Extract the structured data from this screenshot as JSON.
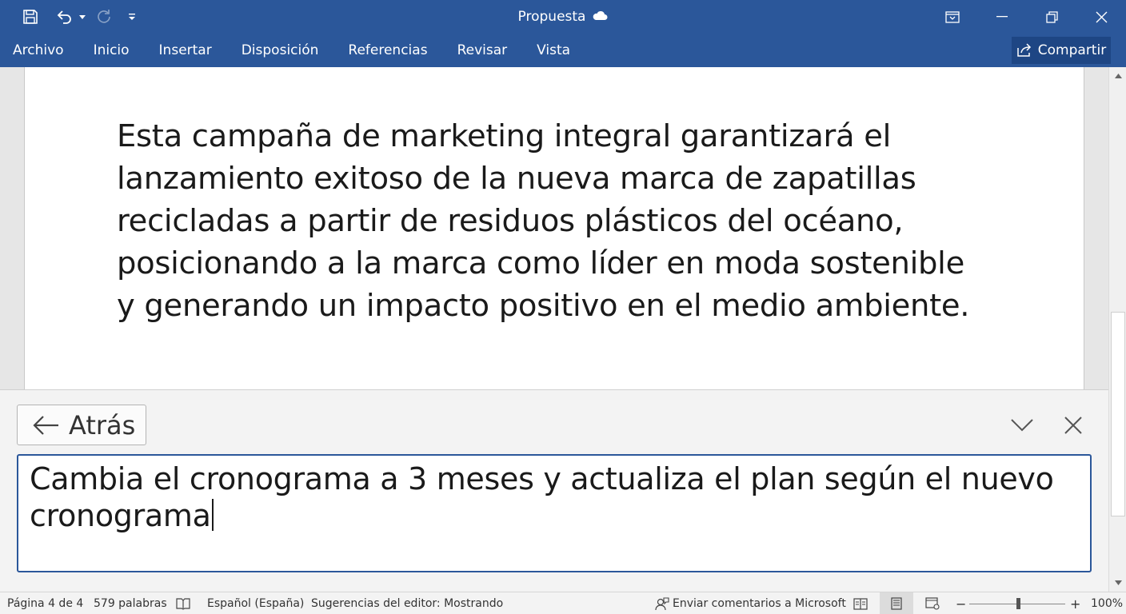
{
  "app": {
    "document_title": "Propuesta",
    "cloud_icon": "cloud-icon"
  },
  "quick_access": [
    {
      "name": "save-icon"
    },
    {
      "name": "undo-icon"
    },
    {
      "name": "undo-dropdown-icon"
    },
    {
      "name": "redo-icon"
    },
    {
      "name": "customize-toolbar-icon"
    }
  ],
  "window_controls": [
    "ribbon-display-options-icon",
    "minimize-icon",
    "restore-icon",
    "close-icon"
  ],
  "ribbon": {
    "tabs": [
      "Archivo",
      "Inicio",
      "Insertar",
      "Disposición",
      "Referencias",
      "Revisar",
      "Vista"
    ],
    "share_label": "Compartir"
  },
  "document": {
    "paragraph": "Esta campaña de marketing integral garantizará el lanzamiento exitoso de la nueva marca de zapatillas recicladas a partir de residuos plásticos del océano, posicionando a la marca como líder en moda sostenible y generando un impacto positivo en el medio ambiente."
  },
  "panel": {
    "back_label": "Atrás",
    "prompt_value": "Cambia el cronograma a 3 meses y actualiza el plan según el nuevo cronograma"
  },
  "status_bar": {
    "page": "Página 4 de 4",
    "words": "579 palabras",
    "language": "Español (España)",
    "editor": "Sugerencias del editor: Mostrando",
    "feedback": "Enviar comentarios a Microsoft",
    "zoom_minus": "−",
    "zoom_plus": "+",
    "zoom_level": "100%",
    "zoom_fraction": 0.5
  },
  "colors": {
    "accent": "#2b579a",
    "share_bg": "#1e4684"
  }
}
